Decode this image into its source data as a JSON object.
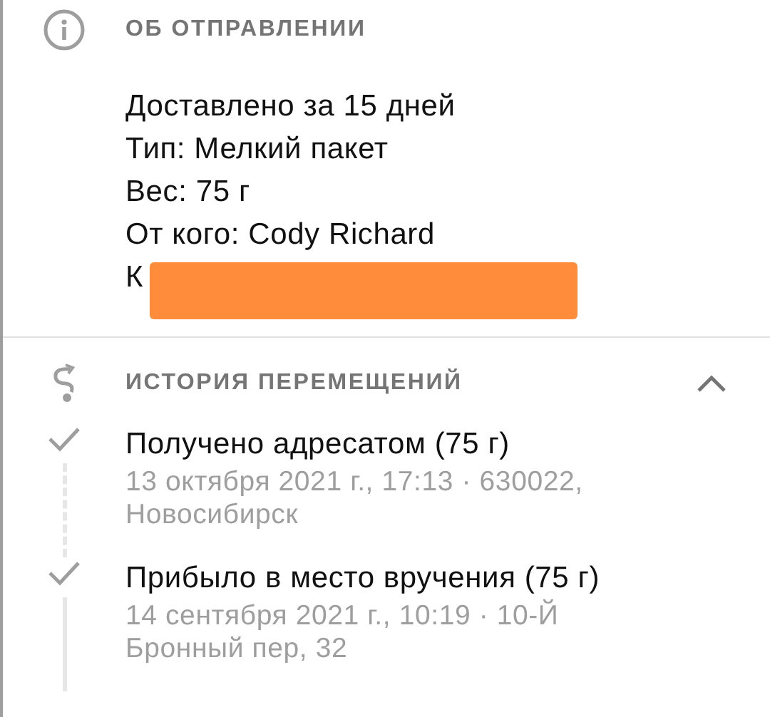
{
  "shipment": {
    "title": "ОБ ОТПРАВЛЕНИИ",
    "lines": [
      "Доставлено за 15 дней",
      "Тип: Мелкий пакет",
      "Вес: 75 г",
      "От кого: Cody Richard"
    ],
    "recipient_visible": "К",
    "redacted": true
  },
  "history": {
    "title": "ИСТОРИЯ ПЕРЕМЕЩЕНИЙ",
    "expanded": true,
    "events": [
      {
        "title": "Получено адресатом (75 г)",
        "details": "13 октября 2021 г., 17:13 · 630022, Новосибирск",
        "dashed_line": true
      },
      {
        "title": "Прибыло в место вручения (75 г)",
        "details": "14 сентября 2021 г., 10:19 · 10-Й Бронный пер, 32",
        "dashed_line": false
      }
    ]
  }
}
